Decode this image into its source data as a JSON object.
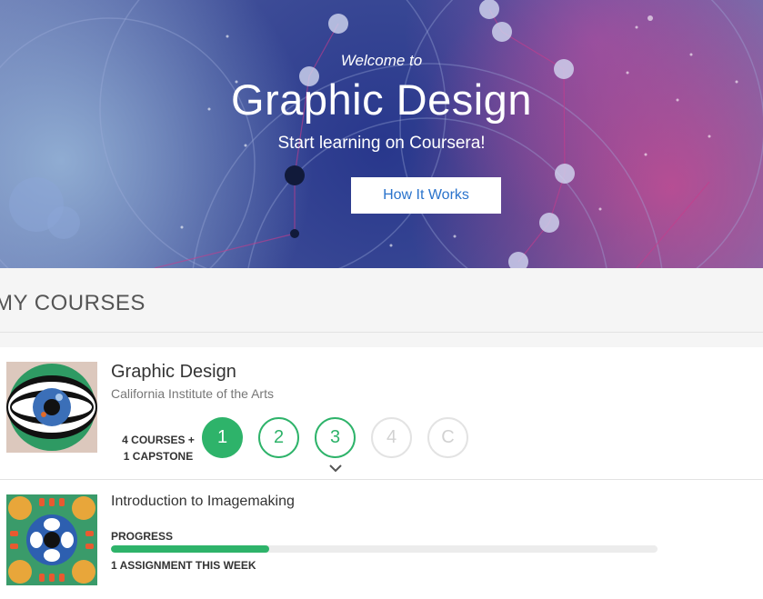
{
  "hero": {
    "welcome": "Welcome to",
    "title": "Graphic Design",
    "subtitle": "Start learning on Coursera!",
    "cta_label": "How It Works"
  },
  "section": {
    "title": "MY COURSES"
  },
  "specialization": {
    "title": "Graphic Design",
    "org": "California Institute of the Arts",
    "count_line1": "4 COURSES +",
    "count_line2": "1 CAPSTONE",
    "steps": [
      {
        "label": "1",
        "state": "active"
      },
      {
        "label": "2",
        "state": "done"
      },
      {
        "label": "3",
        "state": "done"
      },
      {
        "label": "4",
        "state": "locked"
      },
      {
        "label": "C",
        "state": "locked"
      }
    ],
    "icons": {
      "thumbnail": "eye-logo-icon",
      "expand": "chevron-down-icon"
    }
  },
  "course": {
    "title": "Introduction to Imagemaking",
    "progress_label": "PROGRESS",
    "progress_fraction": 0.29,
    "assignment_text": "1 ASSIGNMENT THIS WEEK",
    "icons": {
      "thumbnail": "pattern-thumbnail-icon"
    }
  },
  "colors": {
    "accent_green": "#2eb36a",
    "link_blue": "#2a73cc",
    "locked_gray": "#d2d2d2"
  }
}
